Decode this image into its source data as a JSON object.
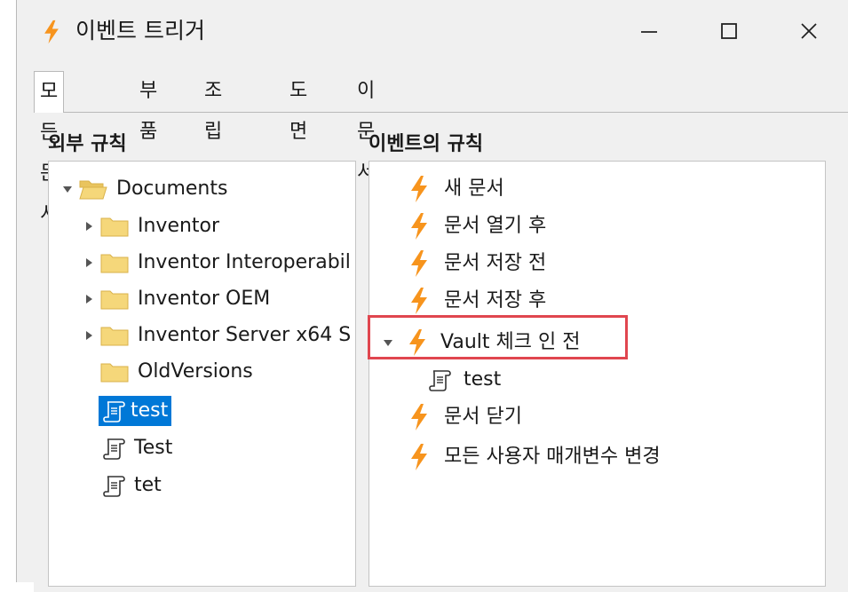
{
  "window": {
    "title": "이벤트 트리거",
    "minimize_icon": "minimize-icon",
    "maximize_icon": "maximize-icon",
    "close_icon": "close-icon"
  },
  "tabs": [
    {
      "label": "모든 문서",
      "active": true
    },
    {
      "label": "부품",
      "active": false
    },
    {
      "label": "조립품",
      "active": false
    },
    {
      "label": "도면",
      "active": false
    },
    {
      "label": "이 문서",
      "active": false
    }
  ],
  "left_panel": {
    "title": "외부 규칙",
    "root": {
      "label": "Documents",
      "expanded": true
    },
    "folders": [
      {
        "label": "Inventor",
        "expandable": true
      },
      {
        "label": "Inventor Interoperabil",
        "expandable": true
      },
      {
        "label": "Inventor OEM",
        "expandable": true
      },
      {
        "label": "Inventor Server x64 S",
        "expandable": true
      },
      {
        "label": "OldVersions",
        "expandable": false
      }
    ],
    "rules": [
      {
        "label": "test",
        "selected": true
      },
      {
        "label": "Test",
        "selected": false
      },
      {
        "label": "tet",
        "selected": false
      }
    ]
  },
  "right_panel": {
    "title": "이벤트의 규칙",
    "events": [
      {
        "label": "새 문서"
      },
      {
        "label": "문서 열기 후"
      },
      {
        "label": "문서 저장 전"
      },
      {
        "label": "문서 저장 후"
      },
      {
        "label": "Vault 체크 인 전",
        "expanded": true,
        "highlighted": true,
        "children": [
          {
            "label": "test"
          }
        ]
      },
      {
        "label": "문서 닫기"
      },
      {
        "label": "모든 사용자 매개변수 변경"
      }
    ]
  },
  "colors": {
    "accent_selection": "#0078d7",
    "bolt_orange": "#f7941d",
    "highlight_red": "#e0464f",
    "folder_yellow": "#f5d77a"
  }
}
